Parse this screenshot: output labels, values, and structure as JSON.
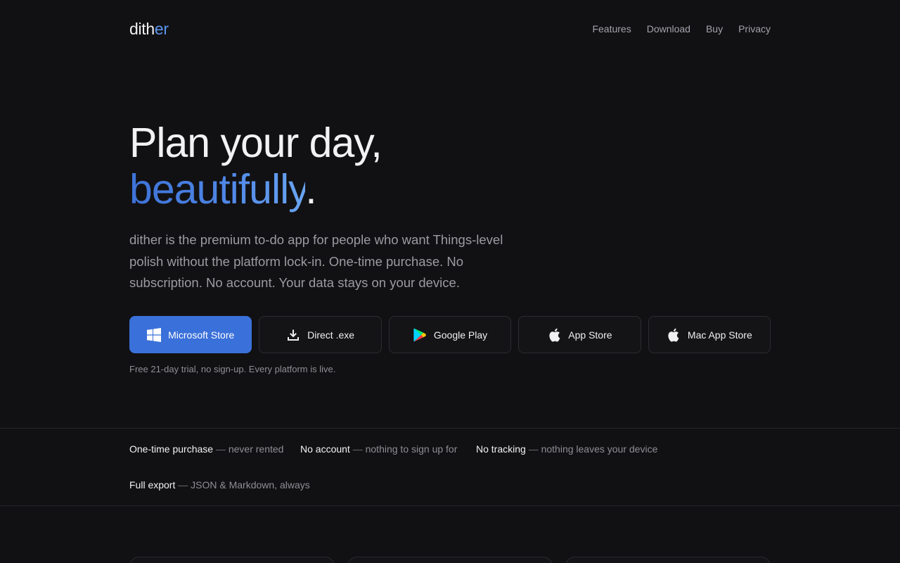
{
  "header": {
    "logo_main": "dith",
    "logo_accent": "er",
    "nav": [
      "Features",
      "Download",
      "Buy",
      "Privacy"
    ]
  },
  "hero": {
    "headline_line1": "Plan your day,",
    "headline_accent": "beautifully",
    "headline_end": ".",
    "lede": "dither is the premium to-do app for people who want Things-level polish without the platform lock-in. One-time purchase. No subscription. No account. Your data stays on your device."
  },
  "stores": [
    {
      "label": "Microsoft Store",
      "icon": "windows-icon"
    },
    {
      "label": "Direct .exe",
      "icon": "download-icon"
    },
    {
      "label": "Google Play",
      "icon": "google-play-icon"
    },
    {
      "label": "App Store",
      "icon": "apple-icon"
    },
    {
      "label": "Mac App Store",
      "icon": "apple-icon"
    }
  ],
  "note": "Free 21-day trial, no sign-up. Every platform is live.",
  "features": [
    {
      "key": "One-time purchase",
      "sep": " — ",
      "value": "never rented"
    },
    {
      "key": "No account",
      "sep": " — ",
      "value": "nothing to sign up for"
    },
    {
      "key": "No tracking",
      "sep": " — ",
      "value": "nothing leaves your device"
    },
    {
      "key": "Full export",
      "sep": " — ",
      "value": "JSON & Markdown, always"
    }
  ],
  "colors": {
    "background": "#111113",
    "accent": "#3a70d9",
    "accent_light": "#5b95ee"
  }
}
